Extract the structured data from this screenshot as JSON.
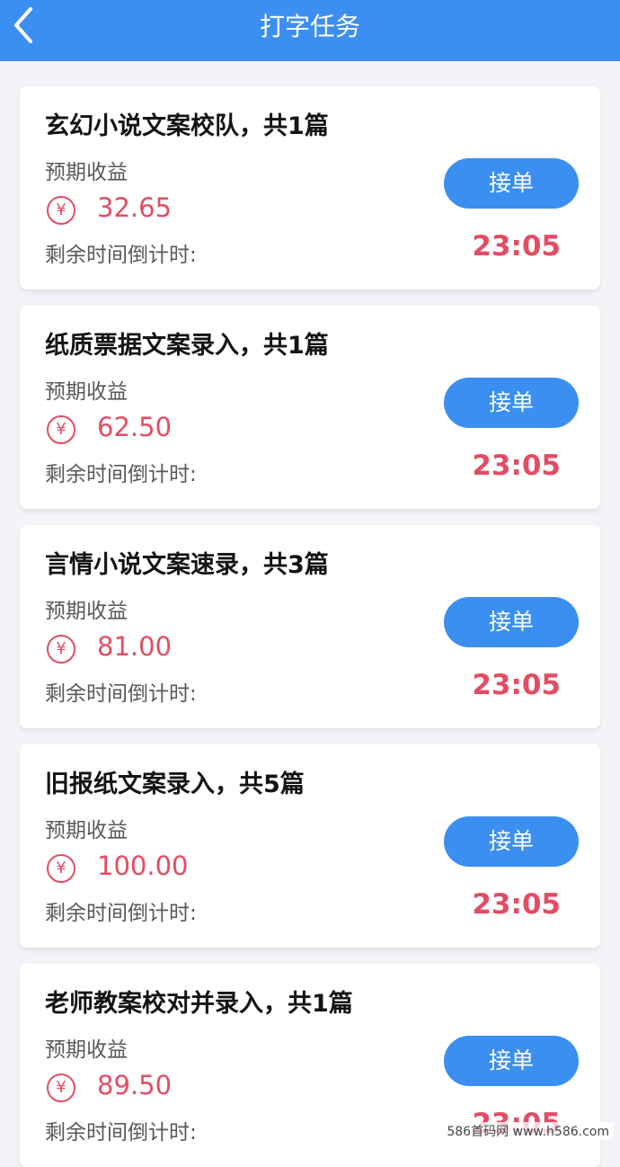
{
  "header": {
    "title": "打字任务",
    "back_icon": "chevron-left-icon"
  },
  "tasks": [
    {
      "title": "玄幻小说文案校队，共1篇",
      "income_label": "预期收益",
      "currency_symbol": "¥",
      "amount": "32.65",
      "countdown_label": "剩余时间倒计时:",
      "countdown": "23:05",
      "button_label": "接单"
    },
    {
      "title": "纸质票据文案录入，共1篇",
      "income_label": "预期收益",
      "currency_symbol": "¥",
      "amount": "62.50",
      "countdown_label": "剩余时间倒计时:",
      "countdown": "23:05",
      "button_label": "接单"
    },
    {
      "title": "言情小说文案速录，共3篇",
      "income_label": "预期收益",
      "currency_symbol": "¥",
      "amount": "81.00",
      "countdown_label": "剩余时间倒计时:",
      "countdown": "23:05",
      "button_label": "接单"
    },
    {
      "title": "旧报纸文案录入，共5篇",
      "income_label": "预期收益",
      "currency_symbol": "¥",
      "amount": "100.00",
      "countdown_label": "剩余时间倒计时:",
      "countdown": "23:05",
      "button_label": "接单"
    },
    {
      "title": "老师教案校对并录入，共1篇",
      "income_label": "预期收益",
      "currency_symbol": "¥",
      "amount": "89.50",
      "countdown_label": "剩余时间倒计时:",
      "countdown": "23:05",
      "button_label": "接单"
    }
  ],
  "watermark": "586首码网 www.h586.com",
  "colors": {
    "primary": "#3b8ff0",
    "accent_red": "#e24d64",
    "background": "#f4f4f8"
  }
}
